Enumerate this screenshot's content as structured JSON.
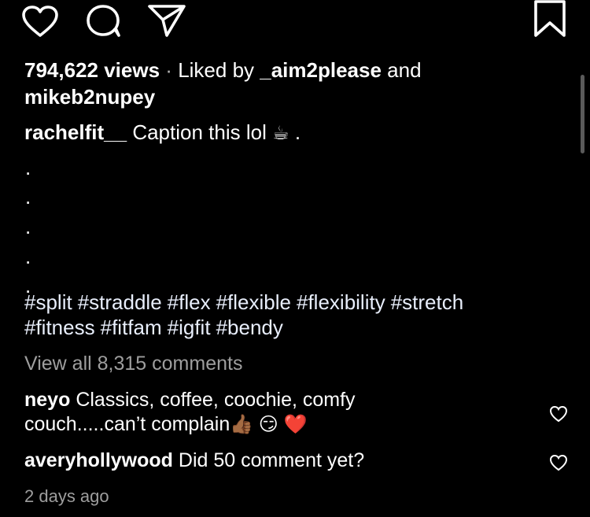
{
  "post": {
    "views": "794,622 views",
    "separator": "·",
    "liked_by_prefix": "Liked by",
    "liked_by_user": "_aim2please",
    "liked_by_and": "and",
    "liked_by_user2": "mikeb2nupey"
  },
  "caption": {
    "username": "rachelfit__",
    "text": "Caption this lol",
    "emoji": "☕",
    "trailing": ".",
    "dots": [
      ".",
      ".",
      ".",
      ".",
      "."
    ],
    "hashtags": [
      "#split",
      "#straddle",
      "#flex",
      "#flexible",
      "#flexibility",
      "#stretch",
      "#fitness",
      "#fitfam",
      "#igfit",
      "#bendy"
    ]
  },
  "comments_link": "View all 8,315 comments",
  "comments": [
    {
      "username": "neyo",
      "text_line1": "Classics, coffee, coochie, comfy",
      "text_line2": "couch.....can’t complain",
      "emojis": "👍🏾 😏 ❤️"
    },
    {
      "username": "averyhollywood",
      "text_line1": "Did 50 comment yet?"
    }
  ],
  "timestamp": "2 days ago",
  "icons": {
    "like": "heart-icon",
    "comment": "comment-bubble-icon",
    "share": "paper-plane-icon",
    "save": "bookmark-icon",
    "comment_like": "heart-outline-icon"
  },
  "colors": {
    "background": "#000000",
    "text": "#ffffff",
    "secondary": "#9e9e9e",
    "hashtag": "#e8eefb"
  }
}
